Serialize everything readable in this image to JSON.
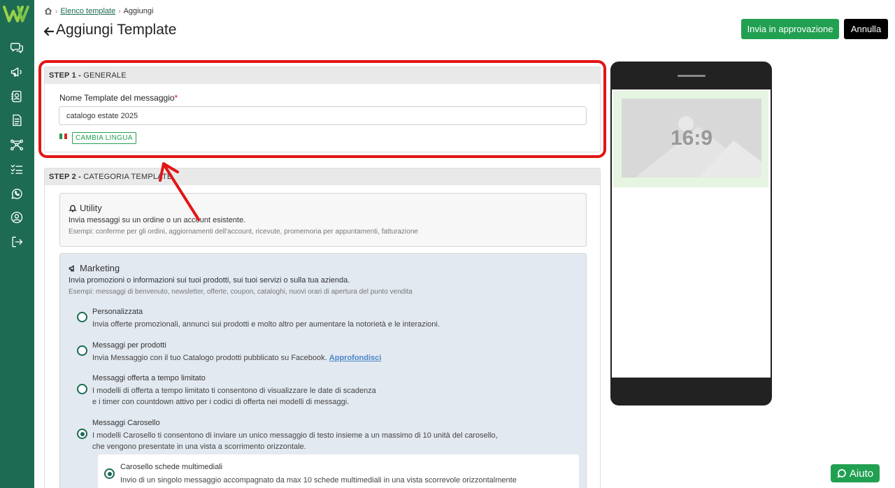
{
  "breadcrumb": {
    "link": "Elenco template",
    "current": "Aggiungi"
  },
  "page": {
    "title": "Aggiungi Template"
  },
  "actions": {
    "approve_label": "Invia in approvazione",
    "cancel_label": "Annulla"
  },
  "step1": {
    "step_label": "STEP 1 - ",
    "title": "GENERALE",
    "field_label": "Nome Template del messaggio",
    "required_mark": "*",
    "field_value": "catalogo estate 2025",
    "lang_button": "CAMBIA LINGUA"
  },
  "step2": {
    "step_label": "STEP 2 - ",
    "title": "CATEGORIA TEMPLATE",
    "utility": {
      "title": "Utility",
      "desc": "Invia messaggi su un ordine o un account esistente.",
      "example": "Esempi: conferme per gli ordini, aggiornamenti dell'account, ricevute, promemoria per appuntamenti, fatturazione"
    },
    "marketing": {
      "title": "Marketing",
      "desc": "Invia promozioni o informazioni sui tuoi prodotti, sui tuoi servizi o sulla tua azienda.",
      "example": "Esempi: messaggi di benvenuto, newsletter, offerte, coupon, cataloghi, nuovi orari di apertura del punto vendita",
      "options": [
        {
          "title": "Personalizzata",
          "desc1": "Invia offerte promozionali, annunci sui prodotti e molto altro per aumentare la notorietà e le interazioni.",
          "checked": false
        },
        {
          "title": "Messaggi per prodotti",
          "desc1": "Invia Messaggio con il tuo Catalogo prodotti pubblicato su Facebook.",
          "link": "Approfondisci",
          "checked": false
        },
        {
          "title": "Messaggi offerta a tempo limitato",
          "desc1": "I modelli di offerta a tempo limitato ti consentono di visualizzare le date di scadenza",
          "desc2": "e i timer con countdown attivo per i codici di offerta nei modelli di messaggi.",
          "checked": false
        },
        {
          "title": "Messaggi Carosello",
          "desc1": "I modelli Carosello ti consentono di inviare un unico messaggio di testo insieme a un massimo di 10 unità del carosello,",
          "desc2": "che vengono presentate in una vista a scorrimento orizzontale.",
          "checked": true
        }
      ],
      "sub_option": {
        "title": "Carosello schede multimediali",
        "desc": "Invio di un singolo messaggio accompagnato da max 10 schede multimediali in una vista scorrevole orizzontalmente",
        "checked": true
      }
    }
  },
  "preview": {
    "media_label": "16:9"
  },
  "help": {
    "label": "Aiuto"
  },
  "colors": {
    "brand": "#1c6b52",
    "accent": "#22a052",
    "annotation": "#e21515"
  },
  "icons": [
    "logo-icon",
    "chat-icon",
    "megaphone-icon",
    "contacts-icon",
    "document-icon",
    "flow-icon",
    "checklist-icon",
    "whatsapp-icon",
    "user-circle-icon",
    "logout-icon",
    "home-icon",
    "back-arrow-icon",
    "bell-icon"
  ]
}
